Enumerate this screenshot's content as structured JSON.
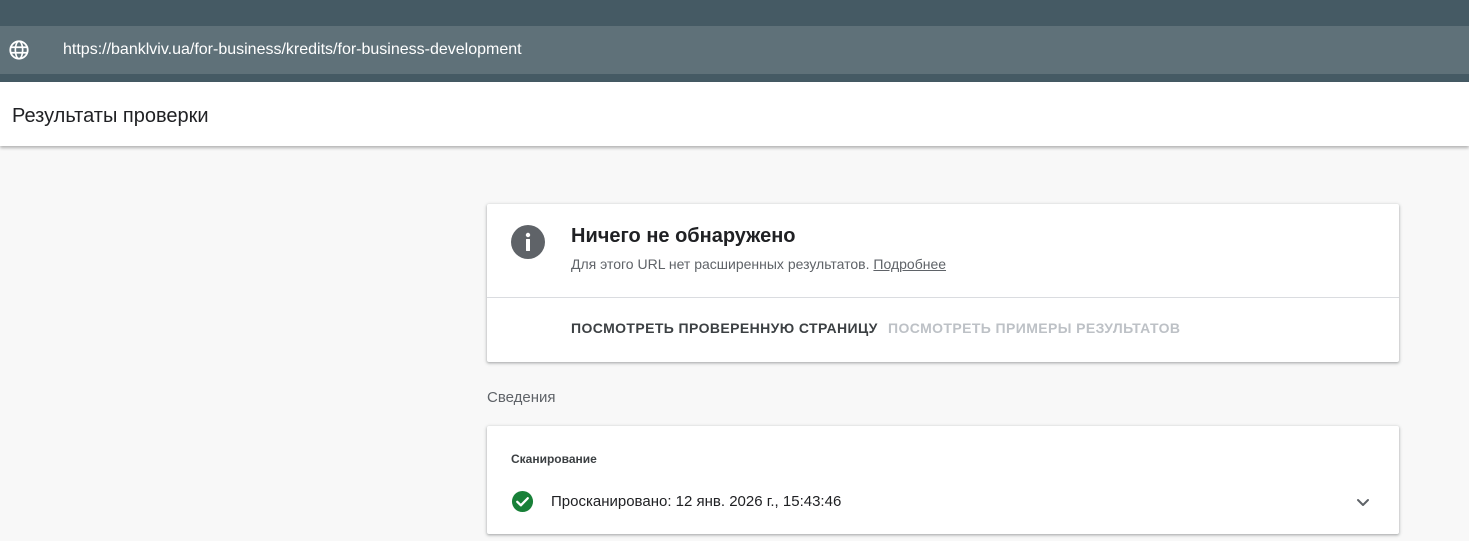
{
  "address_bar": {
    "icon": "globe-icon",
    "url": "https://banklviv.ua/for-business/kredits/for-business-development"
  },
  "header": {
    "title": "Результаты проверки"
  },
  "result_card": {
    "icon": "info-icon",
    "title": "Ничего не обнаружено",
    "description": "Для этого URL нет расширенных результатов.",
    "learn_more_link": "Подробнее",
    "actions": {
      "view_page": "ПОСМОТРЕТЬ ПРОВЕРЕННУЮ СТРАНИЦУ",
      "view_examples": "ПОСМОТРЕТЬ ПРИМЕРЫ РЕЗУЛЬТАТОВ"
    }
  },
  "details": {
    "section_label": "Сведения",
    "crawl_card": {
      "title": "Сканирование",
      "status_icon": "check-circle-icon",
      "status_text": "Просканировано: 12 янв. 2026 г., 15:43:46",
      "expand_icon": "chevron-down-icon"
    }
  },
  "colors": {
    "top_bar": "#455a64",
    "url_bar": "#5f7179",
    "success_green": "#188038",
    "info_gray": "#5f6368"
  }
}
